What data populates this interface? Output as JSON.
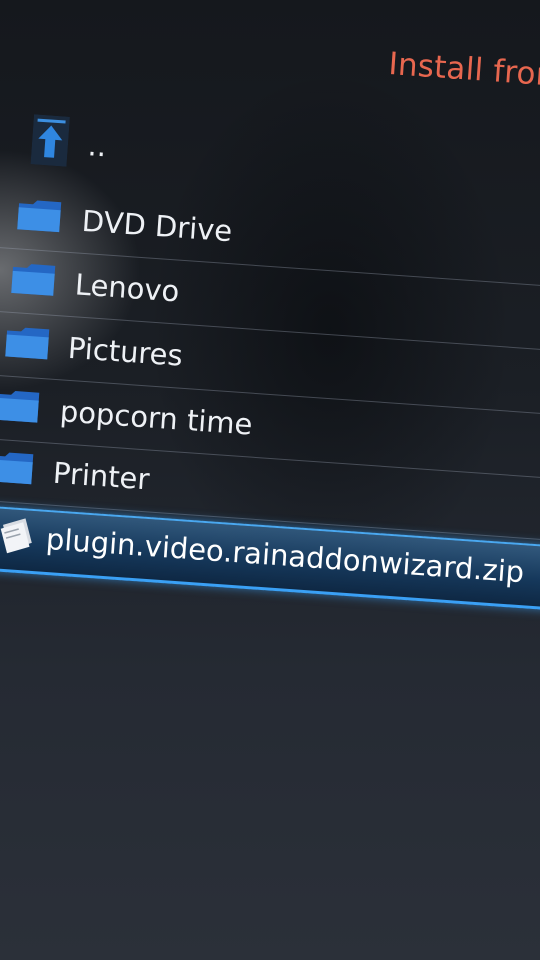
{
  "header": {
    "title": "Install fror"
  },
  "items": [
    {
      "label": "..",
      "icon": "parent-folder-up-icon",
      "type": "parent"
    },
    {
      "label": "DVD Drive",
      "icon": "folder-icon",
      "type": "folder"
    },
    {
      "label": "Lenovo",
      "icon": "folder-icon",
      "type": "folder"
    },
    {
      "label": "Pictures",
      "icon": "folder-icon",
      "type": "folder"
    },
    {
      "label": "popcorn time",
      "icon": "folder-icon",
      "type": "folder"
    },
    {
      "label": "Printer",
      "icon": "folder-icon",
      "type": "folder"
    },
    {
      "label": "plugin.video.rainaddonwizard.zip",
      "icon": "zip-file-icon",
      "type": "file",
      "selected": true
    }
  ],
  "colors": {
    "accent_header": "#e8674f",
    "selection": "#3aa0f5",
    "folder": "#2f7fd8"
  }
}
